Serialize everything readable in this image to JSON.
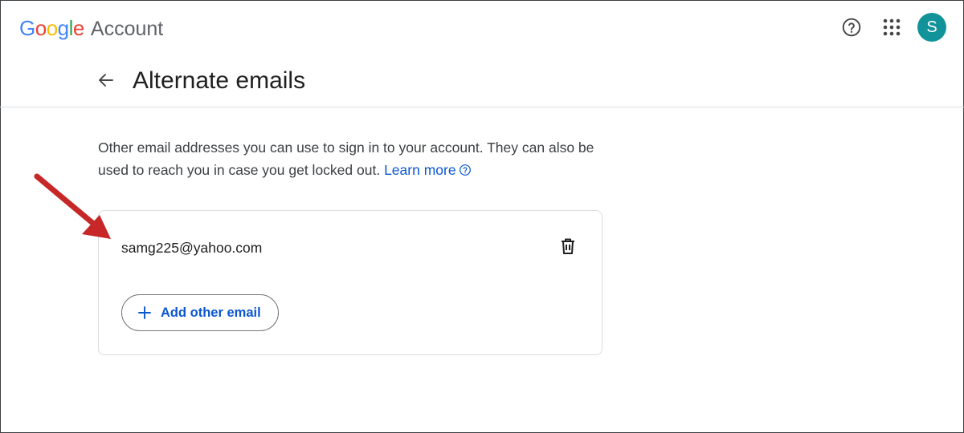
{
  "app": {
    "logo_letters": [
      {
        "char": "G",
        "color": "#4285F4"
      },
      {
        "char": "o",
        "color": "#EA4335"
      },
      {
        "char": "o",
        "color": "#FBBC05"
      },
      {
        "char": "g",
        "color": "#4285F4"
      },
      {
        "char": "l",
        "color": "#34A853"
      },
      {
        "char": "e",
        "color": "#EA4335"
      }
    ],
    "logo_suffix": "Account"
  },
  "header": {
    "help_icon": "help-circle-icon",
    "apps_icon": "apps-grid-icon",
    "avatar_initial": "S",
    "avatar_color": "#12939a"
  },
  "page": {
    "title": "Alternate emails",
    "description": "Other email addresses you can use to sign in to your account. They can also be used to reach you in case you get locked out.",
    "learn_more": "Learn more"
  },
  "card": {
    "email": "samg225@yahoo.com",
    "delete_icon": "trash-icon",
    "add_button_label": "Add other email"
  },
  "colors": {
    "link": "#0b57d0",
    "annotation_arrow": "#c62828"
  }
}
